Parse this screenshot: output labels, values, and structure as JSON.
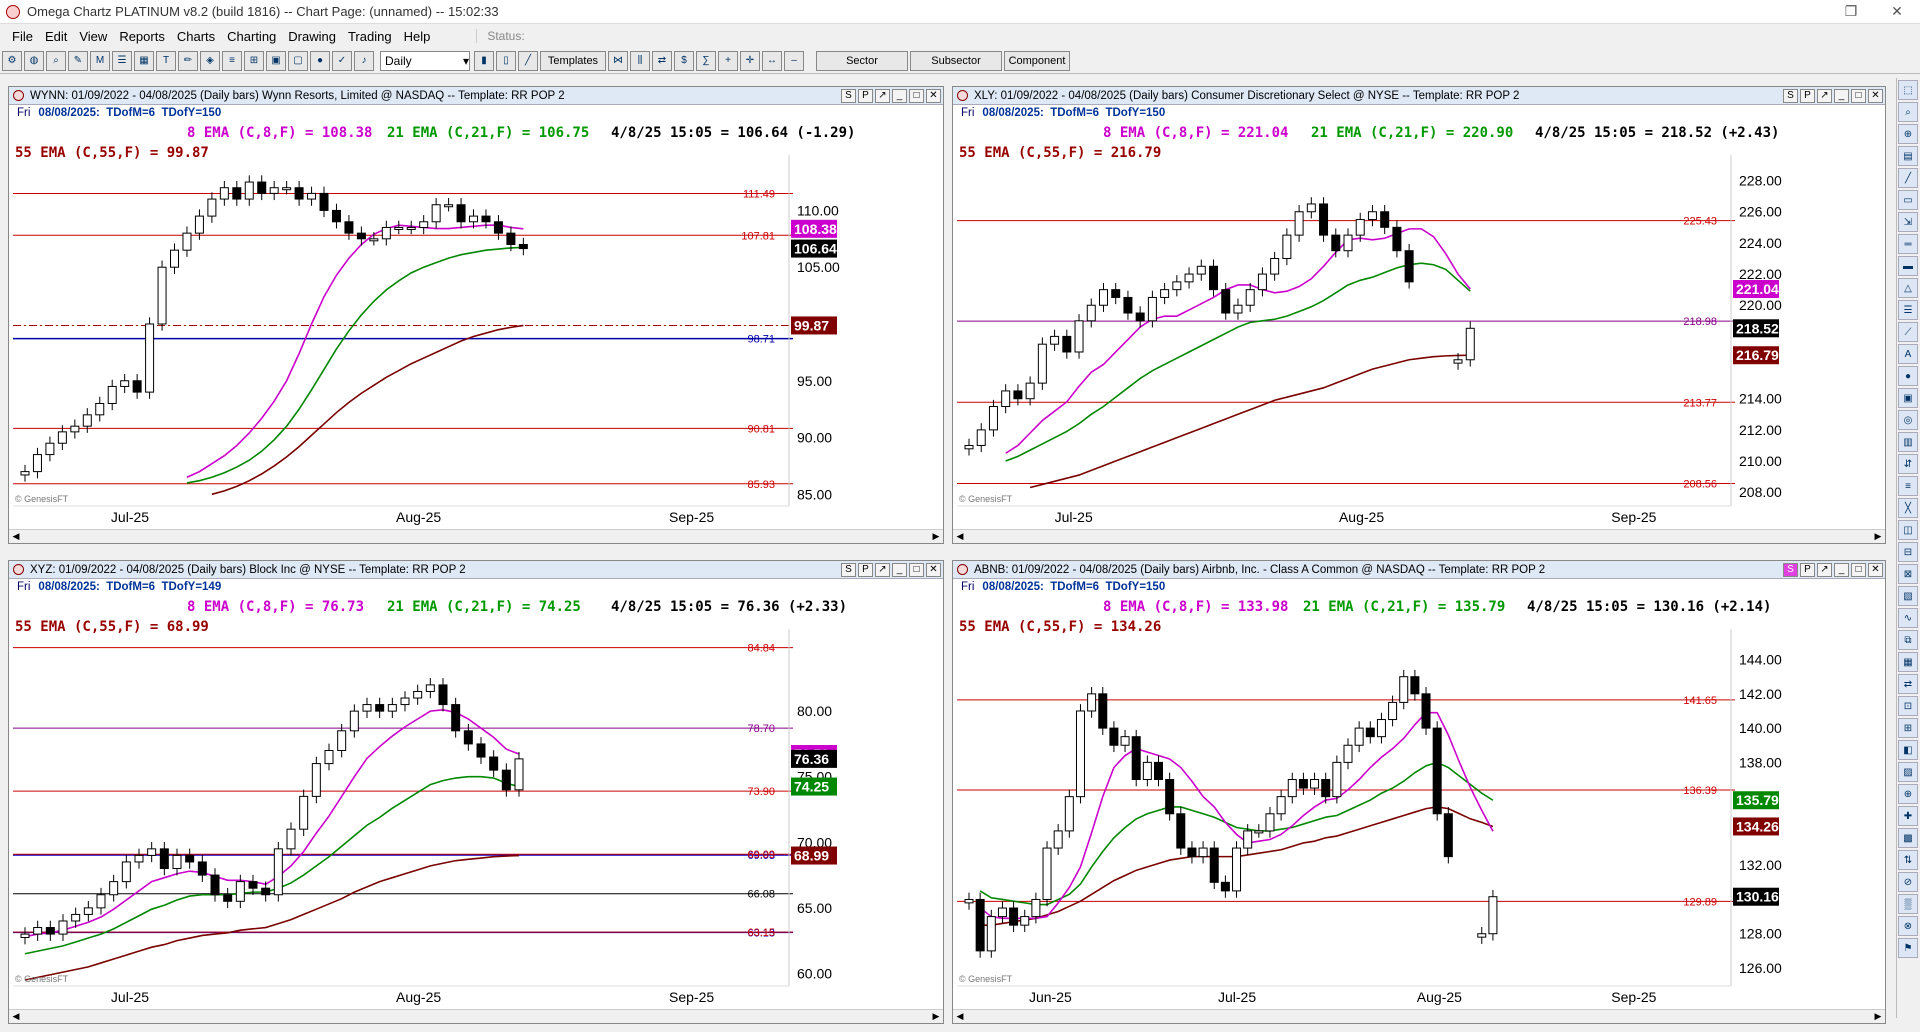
{
  "window": {
    "title": "Omega Chartz PLATINUM v8.2 (build 1816)  --  Chart Page: (unnamed) -- 15:02:33"
  },
  "menu": [
    "File",
    "Edit",
    "View",
    "Reports",
    "Charts",
    "Charting",
    "Drawing",
    "Trading",
    "Help"
  ],
  "status_label": "Status:",
  "toolbar": {
    "interval": "Daily",
    "templates": "Templates",
    "sector": "Sector",
    "subsector": "Subsector",
    "component": "Component"
  },
  "panels": [
    {
      "header": "WYNN:  01/09/2022 - 04/08/2025  (Daily bars)   Wynn Resorts, Limited @ NASDAQ  --  Template: RR POP 2",
      "sub_dow": "Fri",
      "sub_date": "08/08/2025:",
      "sub_tdofm": "TDofM=6",
      "sub_tdofy": "TDofY=150",
      "ema8": "8 EMA (C,8,F) = 108.38",
      "ema21": "21 EMA (C,21,F) = 106.75",
      "quote": "4/8/25 15:05 = 106.64 (-1.29)",
      "ema55": "55 EMA (C,55,F) = 99.87",
      "ymin": 84.5,
      "ymax": 114.0,
      "yticks": [
        "110.00",
        "105.00",
        "95.00",
        "90.00",
        "85.00"
      ],
      "ytick_values": [
        110,
        105,
        95,
        90,
        85
      ],
      "xticks": [
        "Jul-25",
        "Aug-25",
        "Sep-25"
      ],
      "levels": [
        {
          "v": 111.49,
          "label": "111.49",
          "color": "#cc0000"
        },
        {
          "v": 107.81,
          "label": "107.81",
          "color": "#cc0000"
        },
        {
          "v": 98.71,
          "label": "98.71",
          "color": "#0000aa"
        },
        {
          "v": 90.81,
          "label": "90.81",
          "color": "#cc0000"
        },
        {
          "v": 85.93,
          "label": "85.93",
          "color": "#cc0000"
        }
      ],
      "dashed": 99.87,
      "tags": [
        {
          "v": 108.38,
          "label": "108.38",
          "bg": "#cc00cc"
        },
        {
          "v": 106.64,
          "label": "106.64",
          "bg": "#000000"
        },
        {
          "v": 99.87,
          "label": "99.87",
          "bg": "#800000"
        }
      ],
      "closes": [
        87.0,
        88.5,
        89.5,
        90.5,
        91.0,
        92.0,
        93.0,
        94.5,
        95.0,
        94.0,
        100.0,
        105.0,
        106.5,
        108.0,
        109.5,
        111.0,
        112.0,
        111.0,
        112.5,
        111.5,
        112.0,
        112.0,
        111.0,
        111.5,
        110.0,
        109.0,
        108.0,
        107.5,
        107.5,
        108.5,
        108.5,
        108.5,
        109.0,
        110.5,
        110.5,
        109.0,
        109.5,
        109.0,
        108.0,
        107.0,
        106.64
      ],
      "ema8_series": [
        86.5,
        87.0,
        87.7,
        88.4,
        89.3,
        90.4,
        91.7,
        93.2,
        95.0,
        97.4,
        100.0,
        102.4,
        104.3,
        105.8,
        107.0,
        107.9,
        108.4,
        108.7,
        108.6,
        108.5,
        108.4,
        108.4,
        108.5,
        108.6,
        108.7,
        108.7,
        108.5,
        108.38
      ],
      "ema21_series": [
        86.0,
        86.2,
        86.5,
        86.9,
        87.4,
        88.0,
        88.8,
        89.8,
        91.0,
        92.5,
        94.2,
        96.0,
        97.8,
        99.4,
        100.8,
        102.0,
        103.0,
        103.8,
        104.5,
        105.0,
        105.4,
        105.8,
        106.1,
        106.3,
        106.5,
        106.6,
        106.7,
        106.75
      ],
      "ema55_series": [
        85.0,
        85.3,
        85.7,
        86.2,
        86.8,
        87.5,
        88.3,
        89.2,
        90.2,
        91.2,
        92.2,
        93.1,
        93.9,
        94.6,
        95.3,
        95.9,
        96.5,
        97.0,
        97.5,
        98.0,
        98.5,
        98.9,
        99.2,
        99.5,
        99.7,
        99.87
      ],
      "days": 41
    },
    {
      "header": "XLY:  01/09/2022 - 04/08/2025  (Daily bars)   Consumer Discretionary Select @ NYSE  --  Template: RR POP 2",
      "sub_dow": "Fri",
      "sub_date": "08/08/2025:",
      "sub_tdofm": "TDofM=6",
      "sub_tdofy": "TDofY=150",
      "ema8": "8 EMA (C,8,F) = 221.04",
      "ema21": "21 EMA (C,21,F) = 220.90",
      "quote": "4/8/25 15:05 = 218.52 (+2.43)",
      "ema55": "55 EMA (C,55,F) = 216.79",
      "ymin": 207.5,
      "ymax": 229.0,
      "yticks": [
        "228.00",
        "226.00",
        "224.00",
        "222.00",
        "220.00",
        "214.00",
        "212.00",
        "210.00",
        "208.00"
      ],
      "ytick_values": [
        228,
        226,
        224,
        222,
        220,
        214,
        212,
        210,
        208
      ],
      "xticks": [
        "Jul-25",
        "Aug-25",
        "Sep-25"
      ],
      "levels": [
        {
          "v": 225.43,
          "label": "225.43",
          "color": "#cc0000"
        },
        {
          "v": 218.98,
          "label": "218.98",
          "color": "#880088"
        },
        {
          "v": 213.77,
          "label": "213.77",
          "color": "#cc0000"
        },
        {
          "v": 208.56,
          "label": "208.56",
          "color": "#cc0000"
        }
      ],
      "dashed": null,
      "tags": [
        {
          "v": 221.04,
          "label": "221.04",
          "bg": "#cc00cc"
        },
        {
          "v": 218.52,
          "label": "218.52",
          "bg": "#000000"
        },
        {
          "v": 216.79,
          "label": "216.79",
          "bg": "#800000"
        }
      ],
      "closes": [
        211.0,
        212.0,
        213.5,
        214.5,
        214.0,
        215.0,
        217.5,
        218.0,
        217.0,
        219.0,
        220.0,
        221.0,
        220.5,
        219.5,
        219.0,
        220.5,
        221.0,
        221.5,
        222.0,
        222.5,
        221.0,
        219.5,
        220.0,
        221.0,
        222.0,
        223.0,
        224.5,
        226.0,
        226.5,
        224.5,
        223.5,
        224.5,
        225.5,
        226.0,
        225.0,
        223.5,
        221.5,
        null,
        null,
        null,
        216.5,
        218.52
      ],
      "ema8_series": [
        210.5,
        211.0,
        211.8,
        212.6,
        213.2,
        213.8,
        214.8,
        215.7,
        216.2,
        217.0,
        217.8,
        218.6,
        219.1,
        219.3,
        219.3,
        219.7,
        220.1,
        220.5,
        221.0,
        221.3,
        221.3,
        221.0,
        220.8,
        220.9,
        221.2,
        221.7,
        222.5,
        223.4,
        224.2,
        224.3,
        224.2,
        224.3,
        224.6,
        224.9,
        224.9,
        224.4,
        223.3,
        222.0,
        221.04
      ],
      "ema21_series": [
        210.0,
        210.3,
        210.7,
        211.1,
        211.5,
        211.9,
        212.4,
        213.0,
        213.5,
        214.1,
        214.7,
        215.3,
        215.8,
        216.2,
        216.6,
        217.0,
        217.4,
        217.8,
        218.2,
        218.6,
        218.9,
        219.0,
        219.1,
        219.3,
        219.6,
        219.9,
        220.3,
        220.8,
        221.3,
        221.6,
        221.8,
        222.1,
        222.4,
        222.6,
        222.7,
        222.6,
        222.3,
        221.6,
        220.9
      ],
      "ema55_series": [
        208.3,
        208.5,
        208.7,
        208.9,
        209.1,
        209.4,
        209.7,
        210.0,
        210.3,
        210.6,
        210.9,
        211.2,
        211.5,
        211.8,
        212.1,
        212.4,
        212.7,
        213.0,
        213.3,
        213.6,
        213.9,
        214.1,
        214.3,
        214.5,
        214.7,
        215.0,
        215.3,
        215.6,
        215.9,
        216.1,
        216.3,
        216.5,
        216.6,
        216.7,
        216.75,
        216.78,
        216.79
      ],
      "days": 42
    },
    {
      "header": "XYZ:  01/09/2022 - 04/08/2025  (Daily bars)   Block Inc @ NYSE  --  Template: RR POP 2",
      "sub_dow": "Fri",
      "sub_date": "08/08/2025:",
      "sub_tdofm": "TDofM=6",
      "sub_tdofy": "TDofY=149",
      "ema8": "8 EMA (C,8,F) = 76.73",
      "ema21": "21 EMA (C,21,F) = 74.25",
      "quote": "4/8/25 15:05 = 76.36 (+2.33)",
      "ema55": "55 EMA (C,55,F) = 68.99",
      "ymin": 59.5,
      "ymax": 85.5,
      "yticks": [
        "80.00",
        "75.00",
        "70.00",
        "65.00",
        "60.00"
      ],
      "ytick_values": [
        80,
        75,
        70,
        65,
        60
      ],
      "xticks": [
        "Jul-25",
        "Aug-25",
        "Sep-25"
      ],
      "levels": [
        {
          "v": 84.84,
          "label": "84.84",
          "color": "#cc0000"
        },
        {
          "v": 78.7,
          "label": "78.70",
          "color": "#880088"
        },
        {
          "v": 73.9,
          "label": "73.90",
          "color": "#cc0000"
        },
        {
          "v": 69.03,
          "label": "69.03",
          "color": "#0000cc"
        },
        {
          "v": 69.09,
          "label": "69.09",
          "color": "#cc0000"
        },
        {
          "v": 66.08,
          "label": "66.08",
          "color": "#000000"
        },
        {
          "v": 63.13,
          "label": "63.13",
          "color": "#0000cc"
        },
        {
          "v": 63.15,
          "label": "63.15",
          "color": "#cc0000"
        }
      ],
      "dashed": null,
      "tags": [
        {
          "v": 76.73,
          "label": "76.73",
          "bg": "#cc00cc"
        },
        {
          "v": 76.36,
          "label": "76.36",
          "bg": "#000000"
        },
        {
          "v": 74.25,
          "label": "74.25",
          "bg": "#008800"
        },
        {
          "v": 68.99,
          "label": "68.99",
          "bg": "#800000"
        }
      ],
      "closes": [
        63.0,
        63.5,
        63.0,
        64.0,
        64.5,
        65.0,
        66.0,
        67.0,
        68.5,
        69.0,
        69.5,
        68.0,
        69.0,
        68.5,
        67.5,
        66.0,
        65.5,
        67.0,
        66.5,
        66.0,
        69.5,
        71.0,
        73.5,
        76.0,
        77.0,
        78.5,
        80.0,
        80.5,
        80.0,
        80.5,
        81.0,
        81.5,
        82.0,
        80.5,
        78.5,
        77.5,
        76.5,
        75.5,
        74.0,
        76.36
      ],
      "ema8_series": [
        62.8,
        63.0,
        63.1,
        63.3,
        63.6,
        63.9,
        64.3,
        64.9,
        65.6,
        66.3,
        67.0,
        67.3,
        67.6,
        67.8,
        67.7,
        67.4,
        67.1,
        67.1,
        67.0,
        66.8,
        67.4,
        68.2,
        69.3,
        70.7,
        72.0,
        73.5,
        75.0,
        76.4,
        77.3,
        78.1,
        78.8,
        79.4,
        80.0,
        80.1,
        79.9,
        79.4,
        78.7,
        78.0,
        77.1,
        76.73
      ],
      "ema21_series": [
        61.5,
        61.7,
        61.9,
        62.1,
        62.4,
        62.7,
        63.0,
        63.4,
        63.9,
        64.4,
        64.9,
        65.2,
        65.6,
        65.9,
        66.0,
        66.0,
        66.0,
        66.1,
        66.2,
        66.2,
        66.5,
        66.9,
        67.5,
        68.2,
        68.9,
        69.7,
        70.5,
        71.3,
        71.9,
        72.6,
        73.2,
        73.8,
        74.4,
        74.7,
        74.9,
        75.0,
        75.0,
        74.9,
        74.5,
        74.25
      ],
      "ema55_series": [
        59.5,
        59.7,
        59.9,
        60.1,
        60.3,
        60.5,
        60.8,
        61.1,
        61.4,
        61.7,
        62.0,
        62.2,
        62.5,
        62.7,
        62.9,
        63.0,
        63.1,
        63.3,
        63.4,
        63.5,
        63.8,
        64.1,
        64.5,
        64.9,
        65.3,
        65.7,
        66.2,
        66.6,
        67.0,
        67.3,
        67.6,
        67.9,
        68.2,
        68.4,
        68.6,
        68.7,
        68.8,
        68.9,
        68.95,
        68.99
      ],
      "days": 40
    },
    {
      "header": "ABNB:  01/09/2022 - 04/08/2025  (Daily bars)   Airbnb, Inc. - Class A Common @ NASDAQ  --  Template: RR POP 2",
      "sub_dow": "Fri",
      "sub_date": "08/08/2025:",
      "sub_tdofm": "TDofM=6",
      "sub_tdofy": "TDofY=150",
      "ema8": "8 EMA (C,8,F) = 133.98",
      "ema21": "21 EMA (C,21,F) = 135.79",
      "quote": "4/8/25 15:05 = 130.16 (+2.14)",
      "ema55": "55 EMA (C,55,F) = 134.26",
      "ymin": 125.3,
      "ymax": 145.2,
      "yticks": [
        "144.00",
        "142.00",
        "140.00",
        "138.00",
        "132.00",
        "128.00",
        "126.00"
      ],
      "ytick_values": [
        144,
        142,
        140,
        138,
        132,
        128,
        126
      ],
      "xticks": [
        "Jun-25",
        "Jul-25",
        "Aug-25",
        "Sep-25"
      ],
      "levels": [
        {
          "v": 141.65,
          "label": "141.65",
          "color": "#cc0000"
        },
        {
          "v": 136.39,
          "label": "136.39",
          "color": "#cc0000"
        },
        {
          "v": 129.89,
          "label": "129.89",
          "color": "#cc0000"
        }
      ],
      "dashed": null,
      "tags": [
        {
          "v": 135.79,
          "label": "135.79",
          "bg": "#008800"
        },
        {
          "v": 134.26,
          "label": "134.26",
          "bg": "#800000"
        },
        {
          "v": 130.16,
          "label": "130.16",
          "bg": "#000000"
        }
      ],
      "closes": [
        130.0,
        127.0,
        129.0,
        129.5,
        128.5,
        129.0,
        130.0,
        133.0,
        134.0,
        136.0,
        141.0,
        142.0,
        140.0,
        139.0,
        139.5,
        137.0,
        138.0,
        137.0,
        135.0,
        133.0,
        132.5,
        133.0,
        131.0,
        130.5,
        133.0,
        134.0,
        134.0,
        135.0,
        136.0,
        137.0,
        136.5,
        137.0,
        136.0,
        138.0,
        139.0,
        140.0,
        139.5,
        140.5,
        141.5,
        143.0,
        142.0,
        140.0,
        135.0,
        132.5,
        null,
        null,
        128.0,
        130.16
      ],
      "ema8_series": [
        129.5,
        129.0,
        128.9,
        128.9,
        128.9,
        128.9,
        129.0,
        129.8,
        130.7,
        131.9,
        133.9,
        136.0,
        137.7,
        138.4,
        138.8,
        138.6,
        138.4,
        138.2,
        137.7,
        136.9,
        136.0,
        135.4,
        134.5,
        133.8,
        133.3,
        133.4,
        133.5,
        133.8,
        134.3,
        134.9,
        135.4,
        135.8,
        135.9,
        136.4,
        137.0,
        137.7,
        138.3,
        138.8,
        139.4,
        140.2,
        140.9,
        140.9,
        139.6,
        138.0,
        136.5,
        135.2,
        133.98
      ],
      "ema21_series": [
        130.5,
        130.1,
        130.0,
        129.9,
        129.8,
        129.7,
        129.7,
        130.0,
        130.3,
        130.9,
        131.9,
        132.8,
        133.6,
        134.2,
        134.7,
        135.0,
        135.2,
        135.4,
        135.4,
        135.2,
        135.0,
        134.8,
        134.5,
        134.2,
        134.1,
        134.0,
        134.0,
        134.1,
        134.2,
        134.4,
        134.6,
        134.8,
        134.9,
        135.2,
        135.5,
        135.8,
        136.2,
        136.5,
        136.9,
        137.4,
        137.8,
        138.0,
        137.7,
        137.2,
        136.7,
        136.2,
        135.79
      ],
      "ema55_series": [
        128.5,
        128.5,
        128.6,
        128.7,
        128.8,
        128.9,
        129.1,
        129.3,
        129.6,
        129.9,
        130.3,
        130.7,
        131.1,
        131.4,
        131.7,
        131.9,
        132.1,
        132.3,
        132.4,
        132.5,
        132.5,
        132.5,
        132.5,
        132.5,
        132.6,
        132.7,
        132.8,
        132.9,
        133.1,
        133.3,
        133.4,
        133.6,
        133.7,
        133.9,
        134.1,
        134.3,
        134.5,
        134.7,
        134.9,
        135.1,
        135.3,
        135.4,
        135.3,
        135.0,
        134.7,
        134.5,
        134.26
      ],
      "days": 48
    }
  ],
  "watermark": "© GenesisFT",
  "panel_buttons": [
    "S",
    "P"
  ]
}
